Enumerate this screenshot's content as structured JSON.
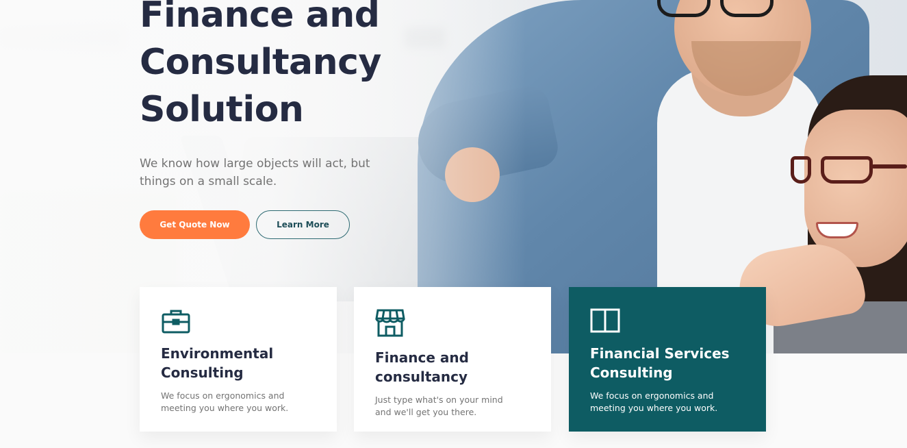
{
  "hero": {
    "headline": "Finance and Consultancy Solution",
    "subtitle": "We know how large objects will act, but things on a small scale.",
    "primary_cta": "Get Quote Now",
    "secondary_cta": "Learn More"
  },
  "cards": [
    {
      "icon": "briefcase-icon",
      "title": "Environmental Consulting",
      "text": "We focus on ergonomics and meeting you where you work."
    },
    {
      "icon": "storefront-icon",
      "title": "Finance and consultancy",
      "text": "Just type what's on your mind and we'll get you there."
    },
    {
      "icon": "book-icon",
      "title": "Financial Services Consulting",
      "text": "We focus on ergonomics and meeting you where you work."
    }
  ],
  "colors": {
    "heading": "#252b42",
    "body_text": "#737373",
    "accent_orange": "#ff7b3e",
    "accent_teal": "#0e5c63",
    "outline_teal": "#2d6a72"
  }
}
